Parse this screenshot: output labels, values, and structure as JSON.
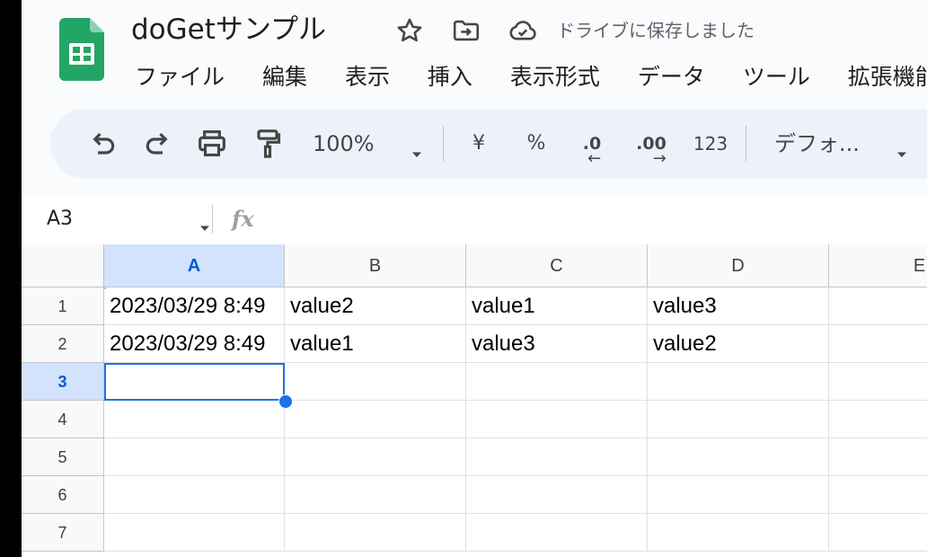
{
  "header": {
    "doc_title": "doGetサンプル",
    "save_status": "ドライブに保存しました",
    "brand_color": "#23a566"
  },
  "menu": {
    "items": [
      "ファイル",
      "編集",
      "表示",
      "挿入",
      "表示形式",
      "データ",
      "ツール",
      "拡張機能"
    ]
  },
  "toolbar": {
    "zoom": "100%",
    "currency": "¥",
    "percent": "%",
    "decrease_decimal": ".0",
    "increase_decimal": ".00",
    "number_format": "123",
    "font": "デフォ...",
    "icons": [
      "undo-icon",
      "redo-icon",
      "print-icon",
      "paint-format-icon"
    ]
  },
  "formula_bar": {
    "name_box": "A3",
    "fx": "fx",
    "value": ""
  },
  "grid": {
    "columns": [
      "A",
      "B",
      "C",
      "D",
      "E"
    ],
    "selected_column": "A",
    "rows": [
      {
        "number": "1",
        "cells": [
          "2023/03/29 8:49",
          "value2",
          "value1",
          "value3",
          ""
        ]
      },
      {
        "number": "2",
        "cells": [
          "2023/03/29 8:49",
          "value1",
          "value3",
          "value2",
          ""
        ]
      },
      {
        "number": "3",
        "cells": [
          "",
          "",
          "",
          "",
          ""
        ]
      },
      {
        "number": "4",
        "cells": [
          "",
          "",
          "",
          "",
          ""
        ]
      },
      {
        "number": "5",
        "cells": [
          "",
          "",
          "",
          "",
          ""
        ]
      },
      {
        "number": "6",
        "cells": [
          "",
          "",
          "",
          "",
          ""
        ]
      },
      {
        "number": "7",
        "cells": [
          "",
          "",
          "",
          "",
          ""
        ]
      }
    ],
    "selected_row": "3",
    "selection_color": "#1a73e8"
  }
}
